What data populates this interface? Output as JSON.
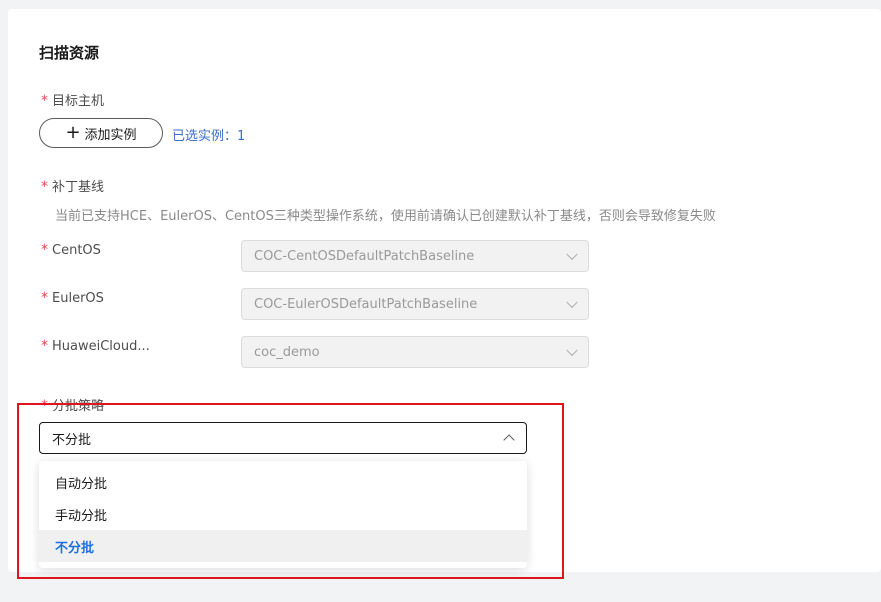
{
  "section": {
    "title": "扫描资源"
  },
  "target_host": {
    "label": "目标主机",
    "required_mark": "*",
    "add_button_label": "添加实例",
    "add_icon": "plus-icon",
    "selected_text": "已选实例：1"
  },
  "patch_baseline": {
    "label": "补丁基线",
    "required_mark": "*",
    "hint": "当前已支持HCE、EulerOS、CentOS三种类型操作系统，使用前请确认已创建默认补丁基线，否则会导致修复失败",
    "rows": [
      {
        "label": "CentOS",
        "value": "COC-CentOSDefaultPatchBaseline"
      },
      {
        "label": "EulerOS",
        "value": "COC-EulerOSDefaultPatchBaseline"
      },
      {
        "label": "HuaweiCloud...",
        "value": "coc_demo"
      }
    ]
  },
  "batch_strategy": {
    "label": "分批策略",
    "required_mark": "*",
    "selected": "不分批",
    "options": [
      {
        "label": "自动分批"
      },
      {
        "label": "手动分批"
      },
      {
        "label": "不分批"
      }
    ]
  },
  "colors": {
    "required": "#e44d4d",
    "link": "#3a6fc9",
    "active_option": "#1e6fe0",
    "highlight_box": "#e0141d"
  }
}
